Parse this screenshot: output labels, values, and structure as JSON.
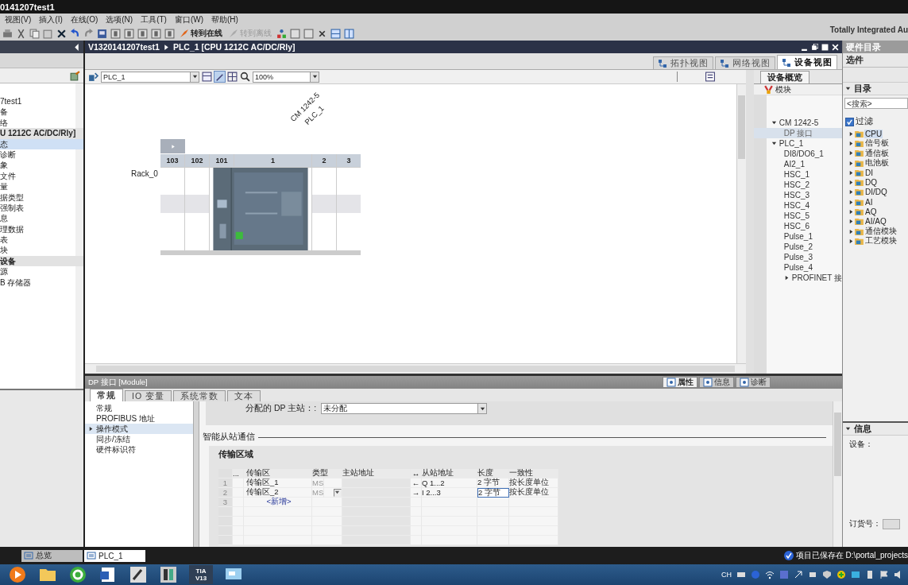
{
  "window": {
    "title": "0141207test1",
    "brand": "Totally Integrated Au"
  },
  "menu": [
    "视图(V)",
    "插入(I)",
    "在线(O)",
    "选项(N)",
    "工具(T)",
    "窗口(W)",
    "帮助(H)"
  ],
  "toolbar_actions": [
    {
      "label": "转到在线",
      "disabled": false
    },
    {
      "label": "转到离线",
      "disabled": true
    }
  ],
  "project_tree": [
    {
      "label": "7test1",
      "kind": "item",
      "selected": false
    },
    {
      "label": "备",
      "kind": "item",
      "selected": false
    },
    {
      "label": "络",
      "kind": "item",
      "selected": false
    },
    {
      "label": "U 1212C AC/DC/Rly]",
      "kind": "group",
      "selected": false
    },
    {
      "label": "态",
      "kind": "item",
      "selected": true
    },
    {
      "label": "诊断",
      "kind": "item",
      "selected": false
    },
    {
      "label": "象",
      "kind": "item",
      "selected": false
    },
    {
      "label": "文件",
      "kind": "item",
      "selected": false
    },
    {
      "label": "量",
      "kind": "item",
      "selected": false
    },
    {
      "label": "据类型",
      "kind": "item",
      "selected": false
    },
    {
      "label": "强制表",
      "kind": "item",
      "selected": false
    },
    {
      "label": "息",
      "kind": "item",
      "selected": false
    },
    {
      "label": "理数据",
      "kind": "item",
      "selected": false
    },
    {
      "label": "表",
      "kind": "item",
      "selected": false
    },
    {
      "label": "块",
      "kind": "item",
      "selected": false
    },
    {
      "label": "设备",
      "kind": "group",
      "selected": false
    },
    {
      "label": "源",
      "kind": "item",
      "selected": false
    },
    {
      "label": "B 存储器",
      "kind": "item",
      "selected": false
    }
  ],
  "editor": {
    "breadcrumb": [
      "V1320141207test1",
      "PLC_1 [CPU 1212C AC/DC/Rly]"
    ],
    "view_tabs": [
      {
        "label": "拓扑视图",
        "selected": false
      },
      {
        "label": "网络视图",
        "selected": false
      },
      {
        "label": "设备视图",
        "selected": true
      }
    ],
    "device_select": "PLC_1",
    "zoom": "100%",
    "module_labels": [
      "CM 1242-5",
      "PLC_1"
    ],
    "rack": {
      "name": "Rack_0",
      "slots": [
        "103",
        "102",
        "101",
        "1",
        "2",
        "3"
      ]
    }
  },
  "device_overview": {
    "tab": "设备概览",
    "column": "模块",
    "rows": [
      {
        "label": "CM 1242-5",
        "expanded": true,
        "selected": false,
        "children": [
          {
            "label": "DP 接口",
            "selected": true
          }
        ]
      },
      {
        "label": "PLC_1",
        "expanded": true,
        "selected": false,
        "children": [
          {
            "label": "DI8/DO6_1",
            "selected": false
          },
          {
            "label": "AI2_1",
            "selected": false
          },
          {
            "label": "HSC_1",
            "selected": false
          },
          {
            "label": "HSC_2",
            "selected": false
          },
          {
            "label": "HSC_3",
            "selected": false
          },
          {
            "label": "HSC_4",
            "selected": false
          },
          {
            "label": "HSC_5",
            "selected": false
          },
          {
            "label": "HSC_6",
            "selected": false
          },
          {
            "label": "Pulse_1",
            "selected": false
          },
          {
            "label": "Pulse_2",
            "selected": false
          },
          {
            "label": "Pulse_3",
            "selected": false
          },
          {
            "label": "Pulse_4",
            "selected": false
          },
          {
            "label": "PROFINET 接",
            "expanded": false,
            "selected": false
          }
        ]
      }
    ]
  },
  "catalog": {
    "title": "硬件目录",
    "options": "选件",
    "section": "目录",
    "search_placeholder": "<搜索>",
    "filter": {
      "label": "过滤",
      "checked": true
    },
    "folders": [
      {
        "label": "CPU",
        "selected": true
      },
      {
        "label": "信号板",
        "selected": false
      },
      {
        "label": "通信板",
        "selected": false
      },
      {
        "label": "电池板",
        "selected": false
      },
      {
        "label": "DI",
        "selected": false
      },
      {
        "label": "DQ",
        "selected": false
      },
      {
        "label": "DI/DQ",
        "selected": false
      },
      {
        "label": "AI",
        "selected": false
      },
      {
        "label": "AQ",
        "selected": false
      },
      {
        "label": "AI/AQ",
        "selected": false
      },
      {
        "label": "通信模块",
        "selected": false
      },
      {
        "label": "工艺模块",
        "selected": false
      }
    ],
    "info": {
      "title": "信息",
      "device_label": "设备：",
      "order_label": "订货号："
    }
  },
  "inspector": {
    "title": "DP 接口 [Module]",
    "panel_tabs": [
      {
        "label": "属性",
        "selected": true
      },
      {
        "label": "信息",
        "selected": false
      },
      {
        "label": "诊断",
        "selected": false
      }
    ],
    "tabs": [
      {
        "label": "常规",
        "selected": true
      },
      {
        "label": "IO 变量",
        "selected": false
      },
      {
        "label": "系统常数",
        "selected": false
      },
      {
        "label": "文本",
        "selected": false
      }
    ],
    "nav": [
      {
        "label": "常规",
        "selected": false
      },
      {
        "label": "PROFIBUS 地址",
        "selected": false
      },
      {
        "label": "操作模式",
        "selected": true
      },
      {
        "label": "同步/冻结",
        "selected": false
      },
      {
        "label": "硬件标识符",
        "selected": false
      }
    ],
    "master_label": "分配的 DP 主站：:",
    "master_value": "未分配",
    "section": "智能从站通信",
    "group": "传输区域",
    "columns": [
      "...",
      "传输区",
      "类型",
      "主站地址",
      "↔",
      "从站地址",
      "长度",
      "一致性"
    ],
    "rows": [
      {
        "index": "1",
        "kind": "area",
        "name": "传输区_1",
        "type": "MS",
        "direction": "←",
        "slave_address": "Q 1...2",
        "length": "2 字节",
        "consistency": "按长度单位",
        "focused": false
      },
      {
        "index": "2",
        "kind": "area",
        "name": "传输区_2",
        "type": "MS",
        "direction": "→",
        "slave_address": "I 2...3",
        "length": "2 字节",
        "consistency": "按长度单位",
        "focused": true
      },
      {
        "index": "3",
        "kind": "add",
        "name": "<新增>"
      }
    ]
  },
  "status_bar": {
    "tabs": [
      {
        "label": "总览",
        "selected": false
      },
      {
        "label": "PLC_1",
        "selected": true
      }
    ],
    "message": "项目已保存在 D:\\portal_projects"
  },
  "taskbar": {
    "tia_label": [
      "TIA",
      "V13"
    ],
    "language": "CH"
  }
}
